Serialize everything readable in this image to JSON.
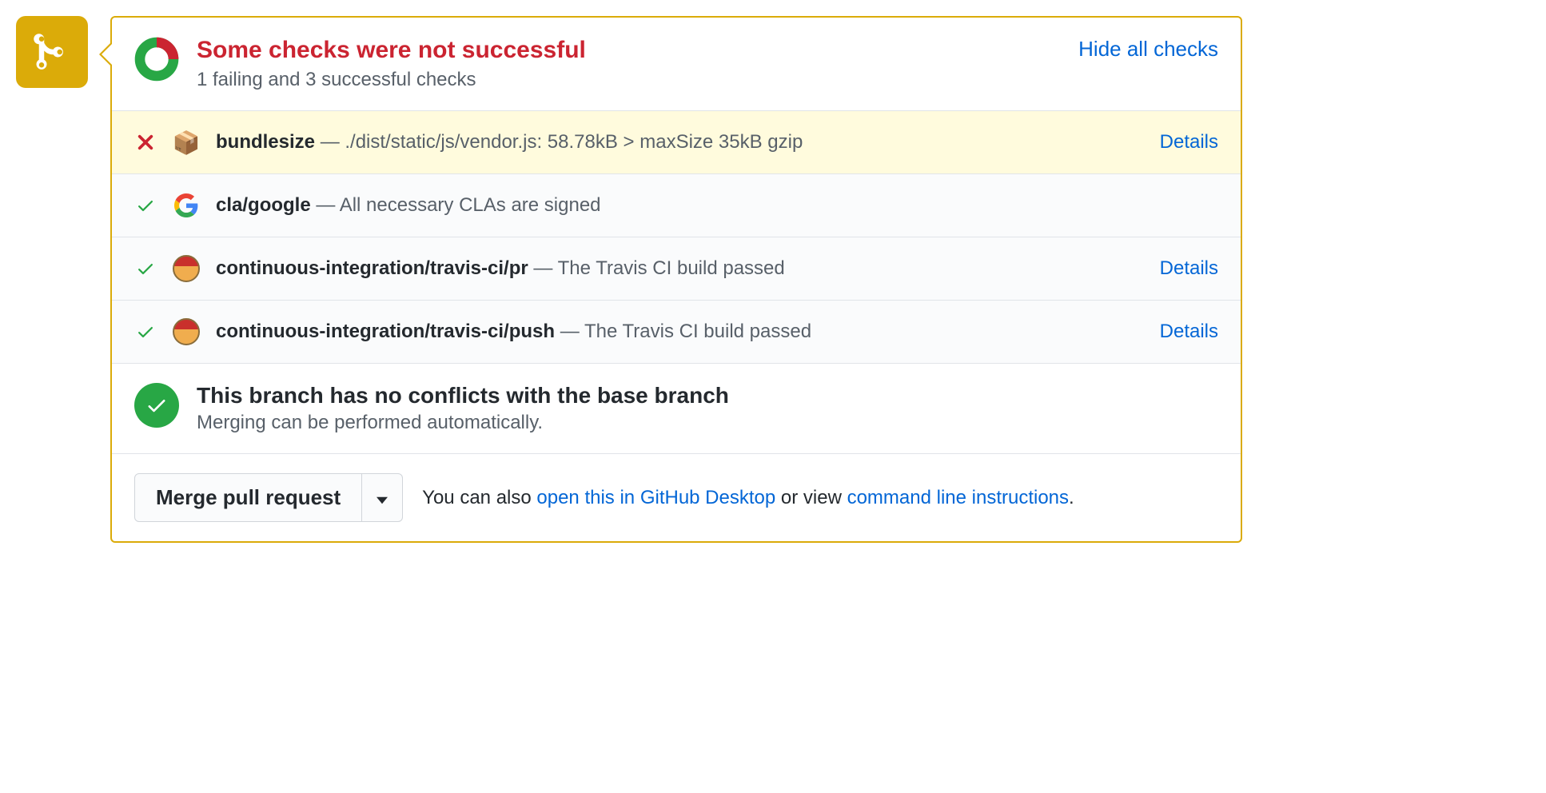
{
  "summary": {
    "title": "Some checks were not successful",
    "subtitle": "1 failing and 3 successful checks",
    "hide_label": "Hide all checks"
  },
  "checks": [
    {
      "status": "fail",
      "icon": "package",
      "name": "bundlesize",
      "sep": " — ",
      "desc": "./dist/static/js/vendor.js: 58.78kB > maxSize 35kB gzip",
      "details": "Details"
    },
    {
      "status": "pass",
      "icon": "google",
      "name": "cla/google",
      "sep": " — ",
      "desc": "All necessary CLAs are signed",
      "details": ""
    },
    {
      "status": "pass",
      "icon": "travis",
      "name": "continuous-integration/travis-ci/pr",
      "sep": " — ",
      "desc": "The Travis CI build passed",
      "details": "Details"
    },
    {
      "status": "pass",
      "icon": "travis",
      "name": "continuous-integration/travis-ci/push",
      "sep": " — ",
      "desc": "The Travis CI build passed",
      "details": "Details"
    }
  ],
  "conflict": {
    "title": "This branch has no conflicts with the base branch",
    "subtitle": "Merging can be performed automatically."
  },
  "merge": {
    "button": "Merge pull request",
    "note_prefix": "You can also ",
    "link1": "open this in GitHub Desktop",
    "note_mid": " or view ",
    "link2": "command line instructions",
    "note_suffix": "."
  }
}
